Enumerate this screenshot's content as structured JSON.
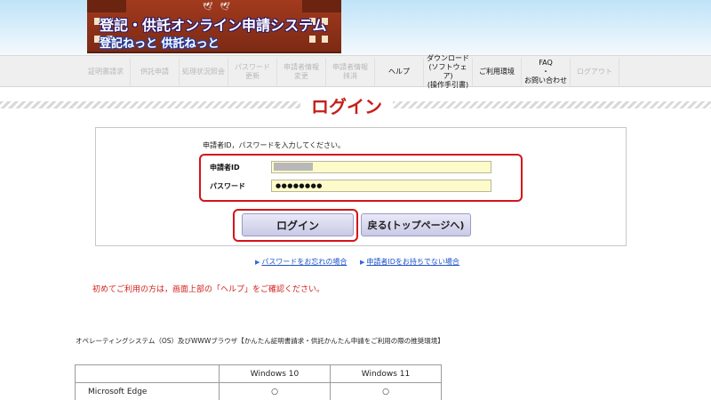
{
  "header": {
    "title": "登記・供託オンライン申請システム",
    "subtitle": "登記ねっと 供託ねっと"
  },
  "nav": {
    "items": [
      {
        "label": "証明書請求",
        "enabled": false
      },
      {
        "label": "供託申請",
        "enabled": false
      },
      {
        "label": "処理状況照会",
        "enabled": false
      },
      {
        "label": "パスワード\n更新",
        "enabled": false
      },
      {
        "label": "申請者情報\n変更",
        "enabled": false
      },
      {
        "label": "申請者情報\n抹消",
        "enabled": false
      },
      {
        "label": "ヘルプ",
        "enabled": true
      },
      {
        "label": "ダウンロード\n(ソフトウェア)\n(操作手引書)",
        "enabled": true
      },
      {
        "label": "ご利用環境",
        "enabled": true
      },
      {
        "label": "FAQ\n・\nお問い合わせ",
        "enabled": true
      },
      {
        "label": "ログアウト",
        "enabled": false
      }
    ]
  },
  "page": {
    "title": "ログイン"
  },
  "login": {
    "instruction": "申請者ID，パスワードを入力してください。",
    "id_label": "申請者ID",
    "password_label": "パスワード",
    "password_value": "●●●●●●●●",
    "login_button": "ログイン",
    "back_button": "戻る(トップページへ)"
  },
  "links": {
    "forgot_password": "パスワードをお忘れの場合",
    "no_id": "申請者IDをお持ちでない場合"
  },
  "notice": "初めてご利用の方は，画面上部の「ヘルプ」をご確認ください。",
  "os_section": {
    "heading": "オペレーティングシステム（OS）及びWWWブラウザ【かんたん証明書請求・供託かんたん申請をご利用の際の推奨環境】",
    "columns": [
      "",
      "Windows 10",
      "Windows 11"
    ],
    "rows": [
      [
        "Microsoft Edge",
        "○",
        "○"
      ]
    ]
  },
  "colors": {
    "accent_red": "#c4201a",
    "highlight_red": "#d4141a",
    "link_blue": "#1f52c9",
    "input_yellow": "#fdfbc9",
    "button_lavender": "#c9c9e6"
  }
}
